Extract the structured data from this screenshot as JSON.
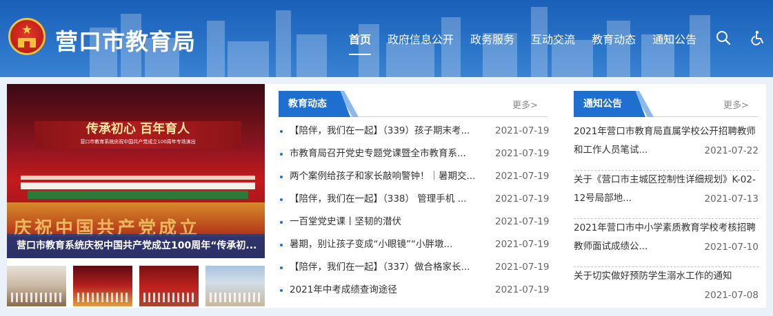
{
  "header": {
    "site_title": "营口市教育局",
    "nav": [
      "首页",
      "政府信息公开",
      "政务服务",
      "互动交流",
      "教育动态",
      "通知公告"
    ],
    "active_index": 0,
    "icons": [
      "search-icon",
      "accessibility-icon"
    ]
  },
  "slider": {
    "banner_title": "传承初心  百年育人",
    "banner_sub": "营口市教育系统庆祝中国共产党成立100周年专场演出",
    "stage_text": "庆祝中国共产党成立",
    "caption": "营口市教育系统庆祝中国共产党成立100周年“传承初..."
  },
  "news": {
    "heading": "教育动态",
    "more": "更多>",
    "items": [
      {
        "title": "【陪伴，我们在一起】（339）孩子期末考...",
        "date": "2021-07-19"
      },
      {
        "title": "市教育局召开党史专题党课暨全市教育系...",
        "date": "2021-07-19"
      },
      {
        "title": "两个案例给孩子和家长敲响警钟！｜暑期交...",
        "date": "2021-07-19"
      },
      {
        "title": "【陪伴，我们在一起】（338） 管理手机 ...",
        "date": "2021-07-19"
      },
      {
        "title": "一百堂党史课丨坚韧的潜伏",
        "date": "2021-07-19"
      },
      {
        "title": "暑期，别让孩子变成“小眼镜”“小胖墩...",
        "date": "2021-07-19"
      },
      {
        "title": "【陪伴，我们在一起】（337）做合格家长...",
        "date": "2021-07-19"
      },
      {
        "title": "2021年中考成绩查询途径",
        "date": "2021-07-19"
      }
    ]
  },
  "notices": {
    "heading": "通知公告",
    "more": "更多>",
    "items": [
      {
        "title": "2021年营口市教育局直属学校公开招聘教师和工作人员笔试...",
        "date": "2021-07-22"
      },
      {
        "title": "关于《营口市主城区控制性详细规划》K-02-12号局部地...",
        "date": "2021-07-13"
      },
      {
        "title": "2021年营口市中小学素质教育学校考核招聘教师面试成绩公...",
        "date": "2021-07-10"
      },
      {
        "title": "关于切实做好预防学生溺水工作的通知",
        "date": "2021-07-08"
      }
    ]
  },
  "colors": {
    "header_blue": "#1a5fb8",
    "accent_blue": "#1f6fd0",
    "page_bg": "#eaf1f8"
  }
}
